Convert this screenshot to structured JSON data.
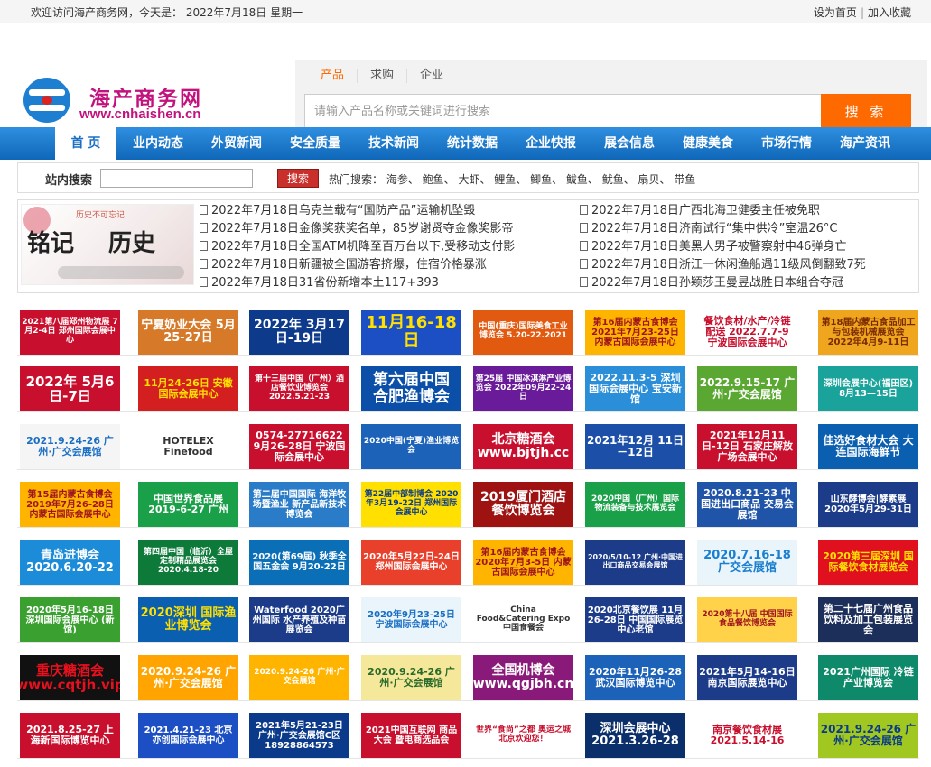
{
  "topbar": {
    "welcome": "欢迎访问海产商务网，今天是： 2022年7月18日 星期一",
    "set_home": "设为首页",
    "favorite": "加入收藏",
    "sep": "|"
  },
  "header": {
    "brand": "海产商务网",
    "domain": "www.cnhaishen.cn"
  },
  "search": {
    "tabs": [
      "产品",
      "求购",
      "企业"
    ],
    "placeholder": "请输入产品名称或关键词进行搜索",
    "button": "搜 索"
  },
  "nav": [
    "首 页",
    "业内动态",
    "外贸新闻",
    "安全质量",
    "技术新闻",
    "统计数据",
    "企业快报",
    "展会信息",
    "健康美食",
    "市场行情",
    "海产资讯"
  ],
  "sitesearch": {
    "label": "站内搜索",
    "button": "搜索",
    "hot": "热门搜索：  海参、 鲍鱼、 大虾、 鲤鱼、 鲫鱼、 鲅鱼、 鱿鱼、 扇贝、 带鱼"
  },
  "news_image": {
    "text1": "铭记",
    "text2": "历史",
    "sub": "历史不可忘记"
  },
  "news_left": [
    "2022年7月18日乌克兰载有“国防产品”运输机坠毁",
    "2022年7月18日金像奖获奖名单，85岁谢贤夺金像奖影帝",
    "2022年7月18日全国ATM机降至百万台以下,受移动支付影",
    "2022年7月18日新疆被全国游客挤爆，住宿价格暴涨",
    "2022年7月18日31省份新增本土117+393"
  ],
  "news_right": [
    "2022年7月18日广西北海卫健委主任被免职",
    "2022年7月18日济南试行“集中供冷”室温26°C",
    "2022年7月18日美黑人男子被警察射中46弹身亡",
    "2022年7月18日浙江一休闲渔船遇11级风倒翻致7死",
    "2022年7月18日孙颖莎王曼昱战胜日本组合夺冠"
  ],
  "ads": [
    [
      {
        "text": "2021第八届郑州物流展 7月2-4日 郑州国际会展中心",
        "bg": "#c8102e",
        "fg": "#ffffff",
        "size": 9
      },
      {
        "text": "宁夏奶业大会 5月25-27日",
        "bg": "#d67a2a",
        "fg": "#ffffff",
        "size": 13
      },
      {
        "text": "2022年 3月17日-19日",
        "bg": "#0d3a8a",
        "fg": "#ffffff",
        "size": 14
      },
      {
        "text": "11月16-18日",
        "bg": "#1c4fc4",
        "fg": "#ffe000",
        "size": 18
      },
      {
        "text": "中国(重庆)国际美食工业博览会 5.20-22.2021",
        "bg": "#e25a10",
        "fg": "#ffffff",
        "size": 9
      },
      {
        "text": "第16届内蒙古食博会 2021年7月23-25日 内蒙古国际会展中心",
        "bg": "#ffb400",
        "fg": "#a0141e",
        "size": 10
      },
      {
        "text": "餐饮食材/水产/冷链配送 2022.7.7-9 宁波国际会展中心",
        "bg": "#ffffff",
        "fg": "#c8102e",
        "size": 11
      },
      {
        "text": "第18届内蒙古食品加工与包装机械展览会 2022年4月9-11日",
        "bg": "#f0a51e",
        "fg": "#7a2a00",
        "size": 10
      }
    ],
    [
      {
        "text": "2022年 5月6日-7日",
        "bg": "#c8102e",
        "fg": "#ffffff",
        "size": 15
      },
      {
        "text": "11月24-26日 安徽国际会展中心",
        "bg": "#d31f1f",
        "fg": "#ffe000",
        "size": 11
      },
      {
        "text": "第十三届中国（广州）酒店餐饮业博览会 2022.5.21-23",
        "bg": "#c8102e",
        "fg": "#ffffff",
        "size": 9
      },
      {
        "text": "第六届中国 合肥渔博会",
        "bg": "#0b4fa8",
        "fg": "#ffffff",
        "size": 17
      },
      {
        "text": "第25届 中国冰淇淋产业博览会 2022年09月22-24日",
        "bg": "#6a1b9a",
        "fg": "#ffffff",
        "size": 9
      },
      {
        "text": "2022.11.3-5 深圳国际会展中心 宝安新馆",
        "bg": "#2a8fd8",
        "fg": "#ffffff",
        "size": 11
      },
      {
        "text": "2022.9.15-17 广州·广交会展馆",
        "bg": "#5aa832",
        "fg": "#ffffff",
        "size": 12
      },
      {
        "text": "深圳会展中心(福田区) 8月13—15日",
        "bg": "#1aa39a",
        "fg": "#ffffff",
        "size": 10
      }
    ],
    [
      {
        "text": "2021.9.24-26 广州·广交会展馆",
        "bg": "#f5f5f5",
        "fg": "#1a6fc3",
        "size": 11
      },
      {
        "text": "HOTELEX Finefood",
        "bg": "#ffffff",
        "fg": "#333333",
        "size": 11
      },
      {
        "text": "0574-27716622 9月26-28日 宁波国际会展中心",
        "bg": "#c8102e",
        "fg": "#ffffff",
        "size": 11
      },
      {
        "text": "2020中国(宁夏)渔业博览会",
        "bg": "#1c62b8",
        "fg": "#ffffff",
        "size": 9
      },
      {
        "text": "北京糖酒会 www.bjtjh.cc",
        "bg": "#c8102e",
        "fg": "#ffffff",
        "size": 14
      },
      {
        "text": "2021年12月 11日－12日",
        "bg": "#1c4fa8",
        "fg": "#ffffff",
        "size": 12
      },
      {
        "text": "2021年12月11日-12日 石家庄解放广场会展中心",
        "bg": "#c8102e",
        "fg": "#ffffff",
        "size": 11
      },
      {
        "text": "佳选好食材大会 大连国际海鲜节",
        "bg": "#0b5fb0",
        "fg": "#ffffff",
        "size": 12
      }
    ],
    [
      {
        "text": "第15届内蒙古食博会 2019年7月26-28日 内蒙古国际会展中心",
        "bg": "#ffb400",
        "fg": "#a0141e",
        "size": 10
      },
      {
        "text": "中国世界食品展 2019-6-27 广州",
        "bg": "#1aa048",
        "fg": "#ffffff",
        "size": 11
      },
      {
        "text": "第二届中国国际 海洋牧场暨渔业 新产品新技术博览会",
        "bg": "#2a7cc8",
        "fg": "#ffffff",
        "size": 10
      },
      {
        "text": "第22届中部制博会 2020年3月19-22日 郑州国际会展中心",
        "bg": "#ffe000",
        "fg": "#0b3a8a",
        "size": 9
      },
      {
        "text": "2019厦门酒店 餐饮博览会",
        "bg": "#9e1212",
        "fg": "#ffffff",
        "size": 14
      },
      {
        "text": "2020中国（广州）国际 物流装备与技术展览会",
        "bg": "#1aa048",
        "fg": "#ffffff",
        "size": 9
      },
      {
        "text": "2020.8.21-23 中国进出口商品 交易会展馆",
        "bg": "#2054a8",
        "fg": "#ffffff",
        "size": 11
      },
      {
        "text": "山东酵博会|酵素展 2020年5月29-31日",
        "bg": "#1c3c8a",
        "fg": "#ffffff",
        "size": 10
      }
    ],
    [
      {
        "text": "青岛进博会 2020.6.20-22",
        "bg": "#1c8cd8",
        "fg": "#ffffff",
        "size": 13
      },
      {
        "text": "第四届中国（临沂）全屋定制精品展览会 2020.4.18-20",
        "bg": "#0e7a3a",
        "fg": "#ffffff",
        "size": 9
      },
      {
        "text": "2020(第69届) 秋季全国五金会 9月20-22日",
        "bg": "#0b6fb8",
        "fg": "#ffffff",
        "size": 10
      },
      {
        "text": "2020年5月22日-24日 郑州国际会展中心",
        "bg": "#e8402a",
        "fg": "#ffffff",
        "size": 10
      },
      {
        "text": "第16届内蒙古食博会 2020年7月3-5日 内蒙古国际会展中心",
        "bg": "#ffb400",
        "fg": "#a0141e",
        "size": 10
      },
      {
        "text": "2020/5/10-12 广州·中国进出口商品交易会展馆",
        "bg": "#1c3c8a",
        "fg": "#ffffff",
        "size": 8
      },
      {
        "text": "2020.7.16-18 广交会展馆",
        "bg": "#eaf4fb",
        "fg": "#1a7fd0",
        "size": 13
      },
      {
        "text": "2020第三届深圳 国际餐饮食材展览会",
        "bg": "#e0101e",
        "fg": "#ffe000",
        "size": 11
      }
    ],
    [
      {
        "text": "2020年5月16-18日 深圳国际会展中心 (新馆)",
        "bg": "#3aa030",
        "fg": "#ffffff",
        "size": 10
      },
      {
        "text": "2020深圳 国际渔业博览会",
        "bg": "#0b5fb0",
        "fg": "#ffe000",
        "size": 13
      },
      {
        "text": "Waterfood 2020广州国际 水产养殖及种苗展览会",
        "bg": "#1c3c8a",
        "fg": "#ffffff",
        "size": 10
      },
      {
        "text": "2020年9月23-25日 宁波国际会展中心",
        "bg": "#eaf4fb",
        "fg": "#1a6fc3",
        "size": 10
      },
      {
        "text": "China Food&Catering Expo 中国食餐会",
        "bg": "#ffffff",
        "fg": "#333333",
        "size": 9
      },
      {
        "text": "2020北京餐饮展 11月26-28日 中国国际展览中心老馆",
        "bg": "#1c3c8a",
        "fg": "#ffffff",
        "size": 10
      },
      {
        "text": "2020第十八届 中国国际食品餐饮博览会",
        "bg": "#ffd24a",
        "fg": "#a0141e",
        "size": 9
      },
      {
        "text": "第二十七届广州食品 饮料及加工包装展览会",
        "bg": "#1c2e5a",
        "fg": "#ffffff",
        "size": 11
      }
    ],
    [
      {
        "text": "重庆糖酒会 www.cqtjh.vip",
        "bg": "#111111",
        "fg": "#e8101e",
        "size": 15
      },
      {
        "text": "2020.9.24-26 广州·广交会展馆",
        "bg": "#ffa400",
        "fg": "#ffffff",
        "size": 12
      },
      {
        "text": "2020.9.24-26 广州·广交会展馆",
        "bg": "#ffb400",
        "fg": "#ffffff",
        "size": 9
      },
      {
        "text": "2020.9.24-26 广州·广交会展馆",
        "bg": "#f5e89a",
        "fg": "#2a6a2a",
        "size": 11
      },
      {
        "text": "全国机博会 www.qgjbh.cn",
        "bg": "#8a1a7a",
        "fg": "#ffffff",
        "size": 14
      },
      {
        "text": "2020年11月26-28 武汉国际博览中心",
        "bg": "#1c62b8",
        "fg": "#ffffff",
        "size": 11
      },
      {
        "text": "2021年5月14-16日 南京国际展览中心",
        "bg": "#1c3c8a",
        "fg": "#ffffff",
        "size": 11
      },
      {
        "text": "2021广州国际 冷链产业博览会",
        "bg": "#0e8a6a",
        "fg": "#ffffff",
        "size": 11
      }
    ],
    [
      {
        "text": "2021.8.25-27 上海新国际博览中心",
        "bg": "#c8102e",
        "fg": "#ffffff",
        "size": 11
      },
      {
        "text": "2021.4.21-23 北京亦创国际会展中心",
        "bg": "#1c4fc4",
        "fg": "#ffffff",
        "size": 10
      },
      {
        "text": "2021年5月21-23日 广州·广交会展馆C区 18928864573",
        "bg": "#0b3a8a",
        "fg": "#ffffff",
        "size": 10
      },
      {
        "text": "2021中国互联网 商品大会 暨电商选品会",
        "bg": "#c8102e",
        "fg": "#ffffff",
        "size": 10
      },
      {
        "text": "世界“食尚”之都 奥运之城 北京欢迎您！",
        "bg": "#ffffff",
        "fg": "#c8102e",
        "size": 9
      },
      {
        "text": "深圳会展中心 2021.3.26-28",
        "bg": "#0b2f6a",
        "fg": "#ffffff",
        "size": 13
      },
      {
        "text": "南京餐饮食材展 2021.5.14-16",
        "bg": "#ffffff",
        "fg": "#c8102e",
        "size": 11
      },
      {
        "text": "2021.9.24-26 广州·广交会展馆",
        "bg": "#a0c820",
        "fg": "#0b3a8a",
        "size": 12
      }
    ]
  ]
}
